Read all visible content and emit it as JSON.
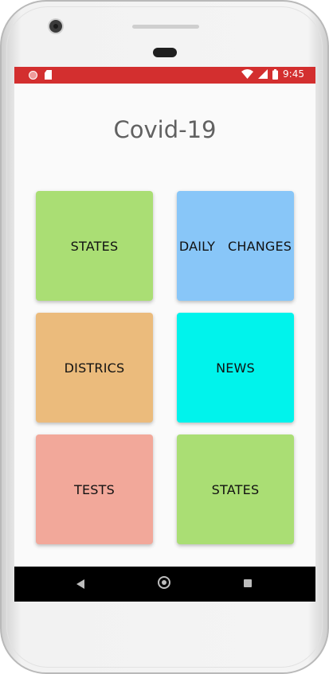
{
  "status_bar": {
    "time": "9:45",
    "left_icons": [
      "notification-dot-icon",
      "sd-card-icon"
    ],
    "right_icons": [
      "wifi-icon",
      "signal-icon",
      "battery-icon"
    ],
    "color": "#d32f2f"
  },
  "app": {
    "title": "Covid-19"
  },
  "tiles": [
    {
      "label": "STATES",
      "color": "#aade74"
    },
    {
      "label": "DAILY   CHANGES",
      "color": "#88c6f8"
    },
    {
      "label": "DISTRICS",
      "color": "#ebbb7c"
    },
    {
      "label": "NEWS",
      "color": "#00f3ec"
    },
    {
      "label": "TESTS",
      "color": "#f2a89a"
    },
    {
      "label": "STATES",
      "color": "#aade74"
    }
  ],
  "nav_bar": {
    "icons": [
      "back-icon",
      "home-icon",
      "recents-icon"
    ]
  }
}
